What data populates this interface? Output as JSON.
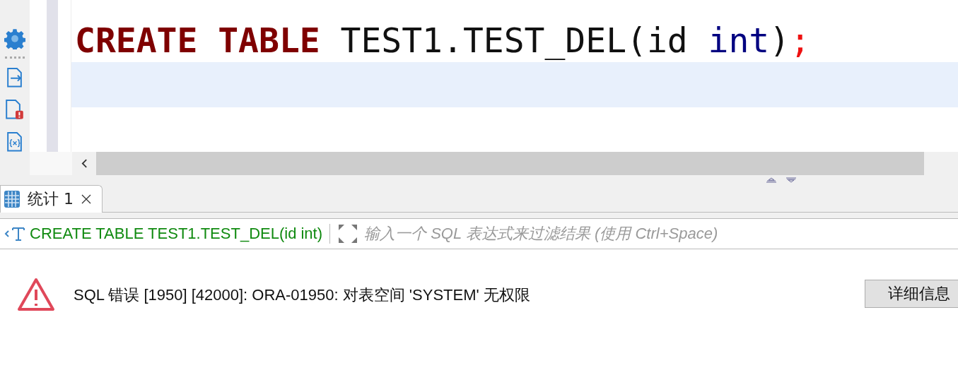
{
  "editor": {
    "tokens": [
      {
        "kind": "keyword",
        "text": "CREATE",
        "gap": true
      },
      {
        "kind": "keyword",
        "text": "TABLE",
        "gap": true
      },
      {
        "kind": "ident",
        "text": "TEST1.TEST_DEL(id",
        "gap": true
      },
      {
        "kind": "type",
        "text": "int"
      },
      {
        "kind": "ident",
        "text": ")"
      },
      {
        "kind": "end",
        "text": ";"
      }
    ]
  },
  "result_tabs": [
    {
      "label": "统计 1",
      "selected": true
    }
  ],
  "filter": {
    "query": "CREATE TABLE TEST1.TEST_DEL(id int)",
    "placeholder": "输入一个 SQL 表达式来过滤结果 (使用 Ctrl+Space)"
  },
  "error": {
    "message": "SQL 错误 [1950] [42000]: ORA-01950: 对表空间 'SYSTEM' 无权限",
    "button": "详细信息"
  }
}
